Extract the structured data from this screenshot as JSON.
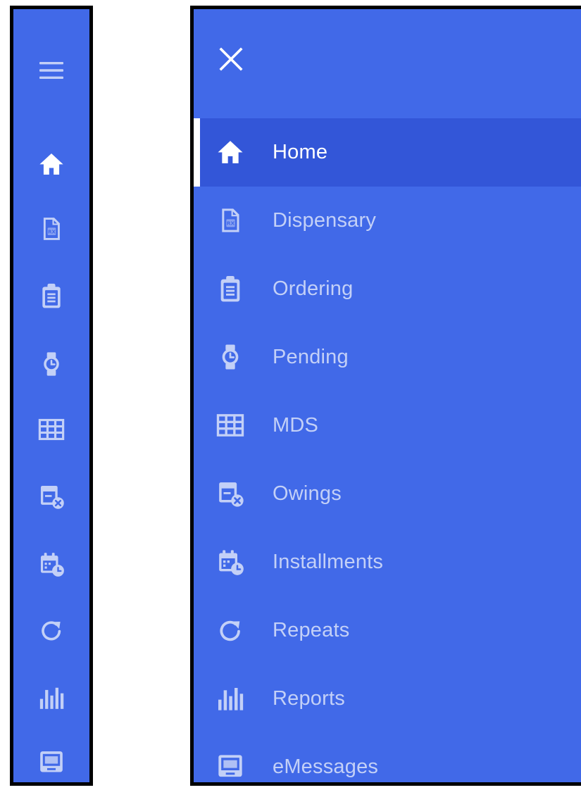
{
  "colors": {
    "sidebar_bg": "#4169e8",
    "active_row_bg": "#3356d8",
    "active_text": "#ffffff",
    "inactive_text": "#c3d0f7",
    "frame_border": "#000000"
  },
  "rail": {
    "menu_icon": "hamburger-menu-icon",
    "items": [
      {
        "icon": "home-icon",
        "active": true
      },
      {
        "icon": "rx-document-icon",
        "active": false
      },
      {
        "icon": "clipboard-icon",
        "active": false
      },
      {
        "icon": "watch-icon",
        "active": false
      },
      {
        "icon": "grid-icon",
        "active": false
      },
      {
        "icon": "box-x-icon",
        "active": false
      },
      {
        "icon": "calendar-clock-icon",
        "active": false
      },
      {
        "icon": "refresh-icon",
        "active": false
      },
      {
        "icon": "bar-chart-icon",
        "active": false
      },
      {
        "icon": "monitor-message-icon",
        "active": false
      }
    ]
  },
  "drawer": {
    "close_icon": "close-icon",
    "items": [
      {
        "label": "Home",
        "icon": "home-icon",
        "active": true
      },
      {
        "label": "Dispensary",
        "icon": "rx-document-icon",
        "active": false
      },
      {
        "label": "Ordering",
        "icon": "clipboard-icon",
        "active": false
      },
      {
        "label": "Pending",
        "icon": "watch-icon",
        "active": false
      },
      {
        "label": "MDS",
        "icon": "grid-icon",
        "active": false
      },
      {
        "label": "Owings",
        "icon": "box-x-icon",
        "active": false
      },
      {
        "label": "Installments",
        "icon": "calendar-clock-icon",
        "active": false
      },
      {
        "label": "Repeats",
        "icon": "refresh-icon",
        "active": false
      },
      {
        "label": "Reports",
        "icon": "bar-chart-icon",
        "active": false
      },
      {
        "label": "eMessages",
        "icon": "monitor-message-icon",
        "active": false
      }
    ]
  }
}
